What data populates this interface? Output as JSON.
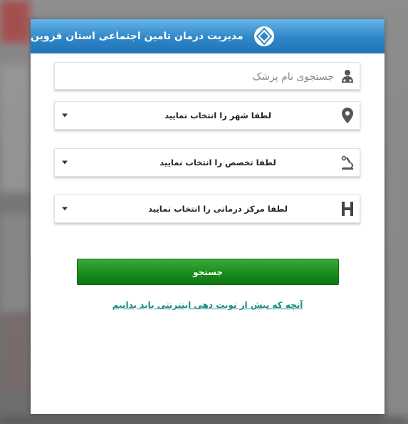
{
  "header": {
    "title": "مدیریت درمان تامین اجتماعی استان قزوین",
    "logo_icon": "social-security-logo-icon"
  },
  "search": {
    "placeholder": "جستجوی نام پزشک",
    "value": "",
    "icon": "doctor-icon"
  },
  "filters": {
    "city": {
      "label": "لطفا شهر را انتخاب نمایید",
      "icon": "map-pin-icon"
    },
    "specialty": {
      "label": "لطفا تخصص را انتخاب نمایید",
      "icon": "microscope-icon"
    },
    "center": {
      "label": "لطفا مرکز درمانی را انتخاب نمایید",
      "icon": "hospital-h-icon"
    }
  },
  "actions": {
    "search_label": "جستجو",
    "info_link": "آنچه که پیش از نوبت دهی اینترنتی باید بدانیم"
  },
  "colors": {
    "header_blue": "#2f86c7",
    "button_green": "#178a1a",
    "link_teal": "#1a8a86"
  }
}
